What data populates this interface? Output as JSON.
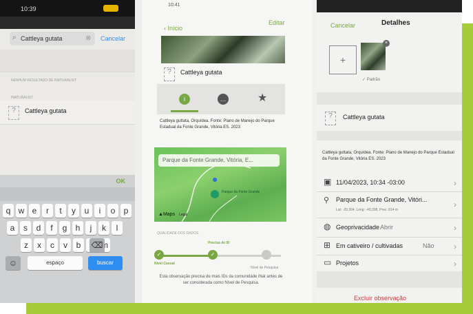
{
  "phone_left": {
    "time": "10:39",
    "search_value": "Cattleya gutata",
    "cancel": "Cancelar",
    "section_header": "NENHUM RESULTADO DE INATURALIST",
    "sub_header": "INATURALIST",
    "result": "Cattleya gutata",
    "ok": "OK",
    "rows": [
      [
        "q",
        "w",
        "e",
        "r",
        "t",
        "y",
        "u",
        "i",
        "o",
        "p"
      ],
      [
        "a",
        "s",
        "d",
        "f",
        "g",
        "h",
        "j",
        "k",
        "l"
      ],
      [
        "z",
        "x",
        "c",
        "v",
        "b",
        "n",
        "m"
      ]
    ],
    "space": "espaço",
    "return": "buscar"
  },
  "phone_middle": {
    "time": "10:41",
    "back": "Início",
    "edit": "Editar",
    "taxon": "Cattleya gutata",
    "description": "Cattleya guttata, Orquídea. Fonte: Plano de Manejo do Parque Estadual da Fonte Grande, Vitória ES. 2023",
    "map_search": "Parque da Fonte Grande, Vitória, E...",
    "map_pin_label": "Parque da Fonte Grande",
    "maps_brand": "Maps",
    "maps_legal": "Legal",
    "quality_header": "QUALIDADE DOS DADOS",
    "quality_steps": [
      "Nível Casual",
      "Precisa de ID",
      "Nível de Pesquisa"
    ],
    "quality_note": "Esta observação precisa de mais IDs da comunidade iNat antes de ser considerada como Nível de Pesquisa."
  },
  "phone_right": {
    "cancel": "Cancelar",
    "title": "Detalhes",
    "add": "+",
    "photo_caption": "Padrão",
    "taxon": "Cattleya gutata",
    "description": "Cattleya guttata, Orquídea. Fonte: Plano de Manejo do Parque Estadual da Fonte Grande, Vitória ES. 2023",
    "date": "11/04/2023, 10:34 -03:00",
    "place": "Parque da Fonte Grande, Vitóri...",
    "coords": "Lat: -20,304, Long: -40,338, Prec: 814 m",
    "geoprivacy_label": "Geoprivacidade",
    "geoprivacy_value": "Abrir",
    "captive_label": "Em cativeiro / cultivadas",
    "captive_value": "Não",
    "projects": "Projetos",
    "delete": "Excluir observação"
  },
  "colors": {
    "frame": "#a7cc3a",
    "ios_blue": "#2e8ef0",
    "inat_green": "#79a743",
    "danger": "#d9363e"
  }
}
